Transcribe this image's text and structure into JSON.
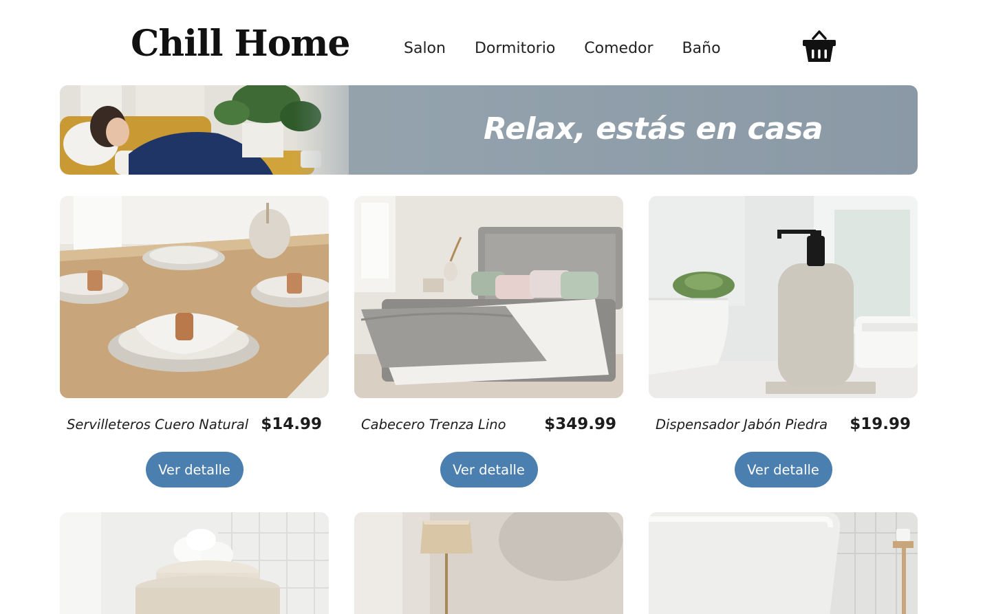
{
  "header": {
    "logo": "Chill Home",
    "nav": [
      "Salon",
      "Dormitorio",
      "Comedor",
      "Baño"
    ],
    "cart_icon": "basket-icon"
  },
  "hero": {
    "title": "Relax, estás en casa"
  },
  "products": [
    {
      "name": "Servilleteros Cuero Natural",
      "price": "$14.99",
      "button": "Ver detalle"
    },
    {
      "name": "Cabecero Trenza Lino",
      "price": "$349.99",
      "button": "Ver detalle"
    },
    {
      "name": "Dispensador Jabón Piedra",
      "price": "$19.99",
      "button": "Ver detalle"
    }
  ],
  "colors": {
    "accent": "#4a7fb0",
    "hero_bg": "#93a2ad"
  }
}
